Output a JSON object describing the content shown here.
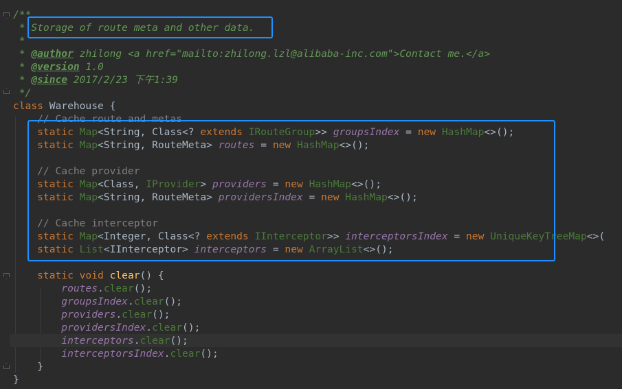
{
  "lines": [
    [
      [
        "c",
        "/**"
      ]
    ],
    [
      [
        "c",
        " * Storage of route meta and other data."
      ]
    ],
    [
      [
        "c",
        " *"
      ]
    ],
    [
      [
        "c",
        " * "
      ],
      [
        "ct",
        "@author"
      ],
      [
        "c",
        " zhilong <a href=\"mailto:zhilong.lzl@alibaba-inc.com\">Contact me.</a>"
      ]
    ],
    [
      [
        "c",
        " * "
      ],
      [
        "ct",
        "@version"
      ],
      [
        "c",
        " 1.0"
      ]
    ],
    [
      [
        "c",
        " * "
      ],
      [
        "ct",
        "@since"
      ],
      [
        "c",
        " 2017/2/23 下午1:39"
      ]
    ],
    [
      [
        "c",
        " */"
      ]
    ],
    [
      [
        "kw",
        "class "
      ],
      [
        "cl",
        "Warehouse "
      ],
      [
        "pl",
        "{"
      ]
    ],
    [
      [
        "lc",
        "    // Cache route and metas"
      ]
    ],
    [
      [
        "kw",
        "    static "
      ],
      [
        "un",
        "Map"
      ],
      [
        "pl",
        "<String, Class<? "
      ],
      [
        "kw",
        "extends "
      ],
      [
        "un",
        "IRouteGroup"
      ],
      [
        "pl",
        ">> "
      ],
      [
        "fi",
        "groupsIndex"
      ],
      [
        "pl",
        " = "
      ],
      [
        "kw",
        "new "
      ],
      [
        "un",
        "HashMap"
      ],
      [
        "pl",
        "<>();"
      ]
    ],
    [
      [
        "kw",
        "    static "
      ],
      [
        "un",
        "Map"
      ],
      [
        "pl",
        "<String, RouteMeta> "
      ],
      [
        "fi",
        "routes"
      ],
      [
        "pl",
        " = "
      ],
      [
        "kw",
        "new "
      ],
      [
        "un",
        "HashMap"
      ],
      [
        "pl",
        "<>();"
      ]
    ],
    [],
    [
      [
        "lc",
        "    // Cache provider"
      ]
    ],
    [
      [
        "kw",
        "    static "
      ],
      [
        "un",
        "Map"
      ],
      [
        "pl",
        "<Class, "
      ],
      [
        "un",
        "IProvider"
      ],
      [
        "pl",
        "> "
      ],
      [
        "fi",
        "providers"
      ],
      [
        "pl",
        " = "
      ],
      [
        "kw",
        "new "
      ],
      [
        "un",
        "HashMap"
      ],
      [
        "pl",
        "<>();"
      ]
    ],
    [
      [
        "kw",
        "    static "
      ],
      [
        "un",
        "Map"
      ],
      [
        "pl",
        "<String, RouteMeta> "
      ],
      [
        "fi",
        "providersIndex"
      ],
      [
        "pl",
        " = "
      ],
      [
        "kw",
        "new "
      ],
      [
        "un",
        "HashMap"
      ],
      [
        "pl",
        "<>();"
      ]
    ],
    [],
    [
      [
        "lc",
        "    // Cache interceptor"
      ]
    ],
    [
      [
        "kw",
        "    static "
      ],
      [
        "un",
        "Map"
      ],
      [
        "pl",
        "<Integer, Class<? "
      ],
      [
        "kw",
        "extends "
      ],
      [
        "un",
        "IInterceptor"
      ],
      [
        "pl",
        ">> "
      ],
      [
        "fi",
        "interceptorsIndex"
      ],
      [
        "pl",
        " = "
      ],
      [
        "kw",
        "new "
      ],
      [
        "un",
        "UniqueKeyTreeMap"
      ],
      [
        "pl",
        "<>("
      ]
    ],
    [
      [
        "kw",
        "    static "
      ],
      [
        "un",
        "List"
      ],
      [
        "pl",
        "<IInterceptor> "
      ],
      [
        "fi",
        "interceptors"
      ],
      [
        "pl",
        " = "
      ],
      [
        "kw",
        "new "
      ],
      [
        "un",
        "ArrayList"
      ],
      [
        "pl",
        "<>();"
      ]
    ],
    [],
    [
      [
        "kw",
        "    static void "
      ],
      [
        "fn",
        "clear"
      ],
      [
        "pl",
        "() {"
      ]
    ],
    [
      [
        "fi",
        "        routes"
      ],
      [
        "pl",
        "."
      ],
      [
        "un",
        "clear"
      ],
      [
        "pl",
        "();"
      ]
    ],
    [
      [
        "fi",
        "        groupsIndex"
      ],
      [
        "pl",
        "."
      ],
      [
        "un",
        "clear"
      ],
      [
        "pl",
        "();"
      ]
    ],
    [
      [
        "fi",
        "        providers"
      ],
      [
        "pl",
        "."
      ],
      [
        "un",
        "clear"
      ],
      [
        "pl",
        "();"
      ]
    ],
    [
      [
        "fi",
        "        providersIndex"
      ],
      [
        "pl",
        "."
      ],
      [
        "un",
        "clear"
      ],
      [
        "pl",
        "();"
      ]
    ],
    [
      [
        "fi",
        "        interceptors"
      ],
      [
        "pl",
        "."
      ],
      [
        "un",
        "clear"
      ],
      [
        "pl",
        "();"
      ]
    ],
    [
      [
        "fi",
        "        interceptorsIndex"
      ],
      [
        "pl",
        "."
      ],
      [
        "un",
        "clear"
      ],
      [
        "pl",
        "();"
      ]
    ],
    [
      [
        "pl",
        "    }"
      ]
    ],
    [
      [
        "pl",
        "}"
      ]
    ]
  ],
  "highlight_color": "#1e90ff"
}
